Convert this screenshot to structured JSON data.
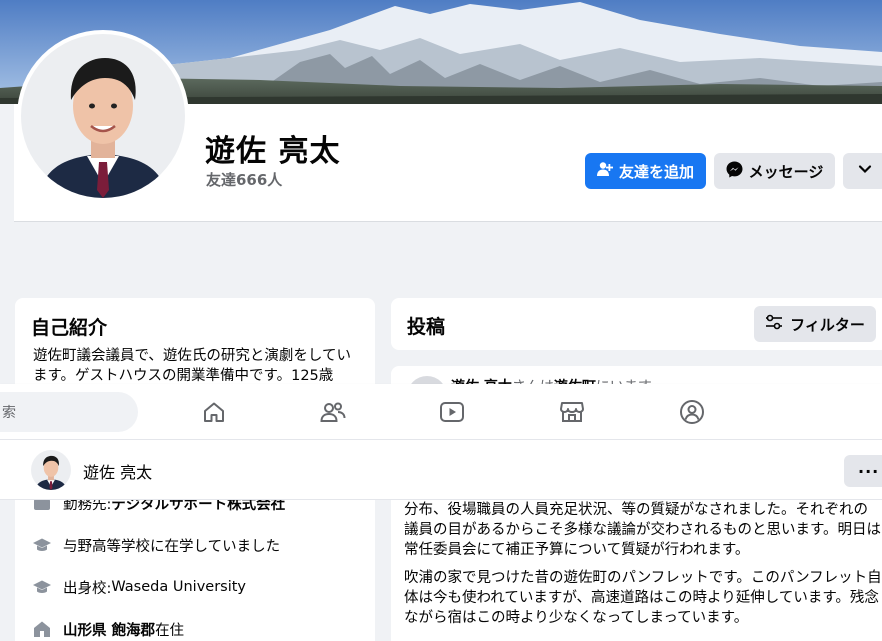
{
  "profile": {
    "name": "遊佐 亮太",
    "friends": "友達666人"
  },
  "actions": {
    "add_friend": "友達を追加",
    "message": "メッセージ"
  },
  "intro": {
    "title": "自己紹介",
    "bio": "遊佐町議会議員で、遊佐氏の研究と演劇をしています。ゲストハウスの開業準備中です。125歳",
    "work_prefix": "勤務先: ",
    "work_org": "デジタルサポート株式会社",
    "school": "与野高等学校に在学していました",
    "alma_prefix": "出身校: ",
    "alma_org": "Waseda University",
    "home_bold": "山形県 飽海郡",
    "home_suffix": "在住"
  },
  "posts": {
    "title": "投稿",
    "filter": "フィルター",
    "author": "遊佐 亮太",
    "author_mid": "さんは",
    "place": "遊佐町",
    "author_tail": "にいます。",
    "para1": "分布、役場職員の人員充足状況、等の質疑がなされました。それぞれの議員の目があるからこそ多様な議論が交わされるものと思います。明日は常任委員会にて補正予算について質疑が行われます。",
    "para2": "吹浦の家で見つけた昔の遊佐町のパンフレットです。このパンフレット自体は今も使われていますが、高速道路はこの時より延伸しています。残念ながら宿はこの時より少なくなってしまっています。"
  },
  "tabbar": {
    "search_text": "索",
    "icons": [
      "home-icon",
      "friends-icon",
      "watch-icon",
      "marketplace-icon",
      "groups-icon"
    ]
  },
  "namebar": {
    "name": "遊佐 亮太",
    "more": "···"
  },
  "colors": {
    "primary": "#1877f2",
    "secondary_btn": "#e4e6eb",
    "background": "#f0f2f5",
    "muted_text": "#65676b"
  }
}
